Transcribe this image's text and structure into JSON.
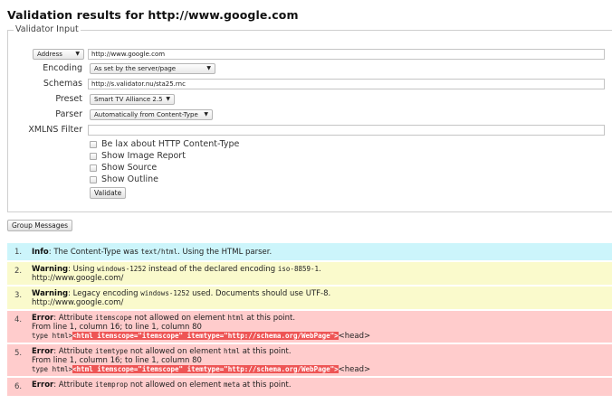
{
  "page_title": "Validation results for http://www.google.com",
  "validator": {
    "legend": "Validator Input",
    "address_select": "Address",
    "address_value": "http://www.google.com",
    "encoding_label": "Encoding",
    "encoding_value": "As set by the server/page",
    "schemas_label": "Schemas",
    "schemas_value": "http://s.validator.nu/sta25.rnc",
    "preset_label": "Preset",
    "preset_value": "Smart TV Alliance 2.5",
    "parser_label": "Parser",
    "parser_value": "Automatically from Content-Type",
    "xmlns_label": "XMLNS Filter",
    "xmlns_value": "",
    "checkboxes": [
      {
        "label": "Be lax about HTTP Content-Type"
      },
      {
        "label": "Show Image Report"
      },
      {
        "label": "Show Source"
      },
      {
        "label": "Show Outline"
      }
    ],
    "validate_button": "Validate"
  },
  "group_messages_button": "Group Messages",
  "messages": [
    {
      "num": "1.",
      "type": "Info",
      "text_a": ": The Content-Type was ",
      "code_a": "text/html",
      "text_b": ". Using the HTML parser."
    },
    {
      "num": "2.",
      "type": "Warning",
      "text_a": ": Using ",
      "code_a": "windows-1252",
      "text_b": " instead of the declared encoding ",
      "code_b": "iso-8859-1",
      "text_c": ".",
      "url": "http://www.google.com/"
    },
    {
      "num": "3.",
      "type": "Warning",
      "text_a": ": Legacy encoding ",
      "code_a": "windows-1252",
      "text_b": " used. Documents should use UTF-8.",
      "url": "http://www.google.com/"
    },
    {
      "num": "4.",
      "type": "Error",
      "text_a": ": Attribute ",
      "code_a": "itemscope",
      "text_b": " not allowed on element ",
      "code_b": "html",
      "text_c": " at this point.",
      "location": "From line 1, column 16; to line 1, column 80",
      "extract_pre": "type html>",
      "extract_hl": "<html itemscope=\"itemscope\" itemtype=\"http://schema.org/WebPage\">",
      "extract_post": "<head>"
    },
    {
      "num": "5.",
      "type": "Error",
      "text_a": ": Attribute ",
      "code_a": "itemtype",
      "text_b": " not allowed on element ",
      "code_b": "html",
      "text_c": " at this point.",
      "location": "From line 1, column 16; to line 1, column 80",
      "extract_pre": "type html>",
      "extract_hl": "<html itemscope=\"itemscope\" itemtype=\"http://schema.org/WebPage\">",
      "extract_post": "<head>"
    },
    {
      "num": "6.",
      "type": "Error",
      "text_a": ": Attribute ",
      "code_a": "itemprop",
      "text_b": " not allowed on element ",
      "code_b": "meta",
      "text_c": " at this point."
    }
  ],
  "colors": {
    "info_bg": "#ccf5fb",
    "warning_bg": "#fafacc",
    "error_bg": "#ffcccc",
    "highlight": "#ee5555"
  }
}
